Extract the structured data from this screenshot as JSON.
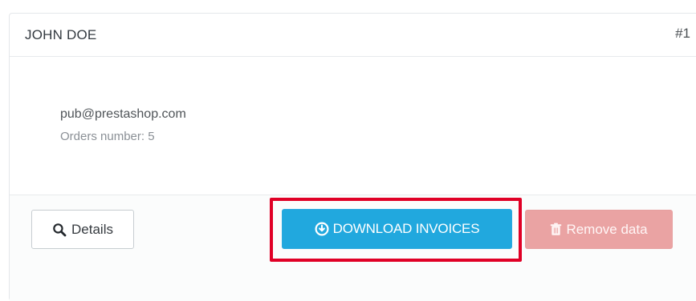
{
  "customer": {
    "name": "JOHN DOE",
    "id": "#1",
    "email": "pub@prestashop.com",
    "orders": "Orders number: 5"
  },
  "actions": {
    "details_label": "Details",
    "download_label": "DOWNLOAD INVOICES",
    "remove_label": "Remove data"
  },
  "icons": {
    "details": "magnifier-icon",
    "download": "download-circle-icon",
    "remove": "trash-icon"
  },
  "colors": {
    "download_button": "#21a8de",
    "remove_button": "#eaa3a3",
    "highlight": "#e00026"
  }
}
